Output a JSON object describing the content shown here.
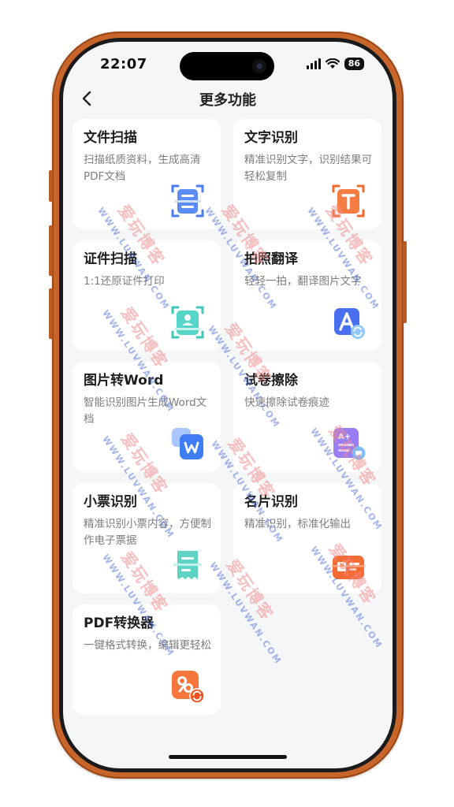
{
  "status_bar": {
    "time": "22:07",
    "battery": "86"
  },
  "header": {
    "title": "更多功能",
    "back_icon": "chevron-left-icon"
  },
  "cards": [
    {
      "title": "文件扫描",
      "desc": "扫描纸质资料，生成高清PDF文档",
      "icon": "document-scan-icon"
    },
    {
      "title": "文字识别",
      "desc": "精准识别文字，识别结果可轻松复制",
      "icon": "text-recognition-icon"
    },
    {
      "title": "证件扫描",
      "desc": "1:1还原证件打印",
      "icon": "id-card-scan-icon"
    },
    {
      "title": "拍照翻译",
      "desc": "轻轻一拍，翻译图片文字",
      "icon": "photo-translate-icon"
    },
    {
      "title": "图片转Word",
      "desc": "智能识别图片生成Word文档",
      "icon": "image-to-word-icon"
    },
    {
      "title": "试卷擦除",
      "desc": "快速擦除试卷痕迹",
      "icon": "exam-erase-icon"
    },
    {
      "title": "小票识别",
      "desc": "精准识别小票内容，方便制作电子票据",
      "icon": "receipt-scan-icon"
    },
    {
      "title": "名片识别",
      "desc": "精准识别，标准化输出",
      "icon": "business-card-icon"
    },
    {
      "title": "PDF转换器",
      "desc": "一键格式转换，编辑更轻松",
      "icon": "pdf-convert-icon"
    }
  ],
  "watermark": {
    "cn": "爱玩博客",
    "en": "WWW.LUVWAN.COM"
  },
  "colors": {
    "blue": "#4a7cf2",
    "orange": "#f26a2c",
    "teal": "#4fd1c5",
    "purple": "#8b6cf0"
  }
}
